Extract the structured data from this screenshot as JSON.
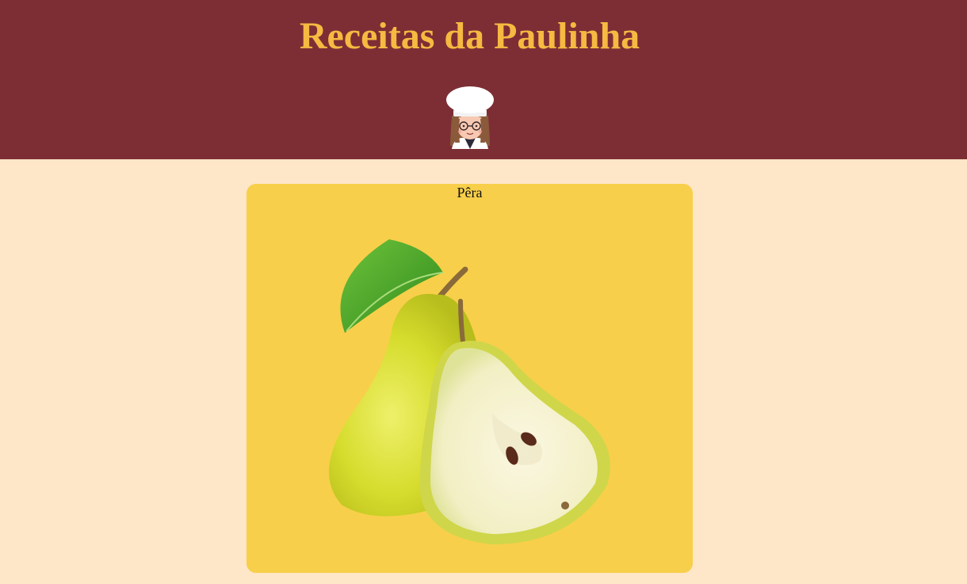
{
  "header": {
    "title": "Receitas da Paulinha",
    "avatar_icon": "chef-girl-icon",
    "background_color": "#7d2e35",
    "title_color": "#f6b941"
  },
  "main": {
    "background_color": "#fee6c8",
    "card": {
      "title": "Pêra",
      "image_icon": "pear-image",
      "background_color": "#f8cf4a"
    }
  }
}
